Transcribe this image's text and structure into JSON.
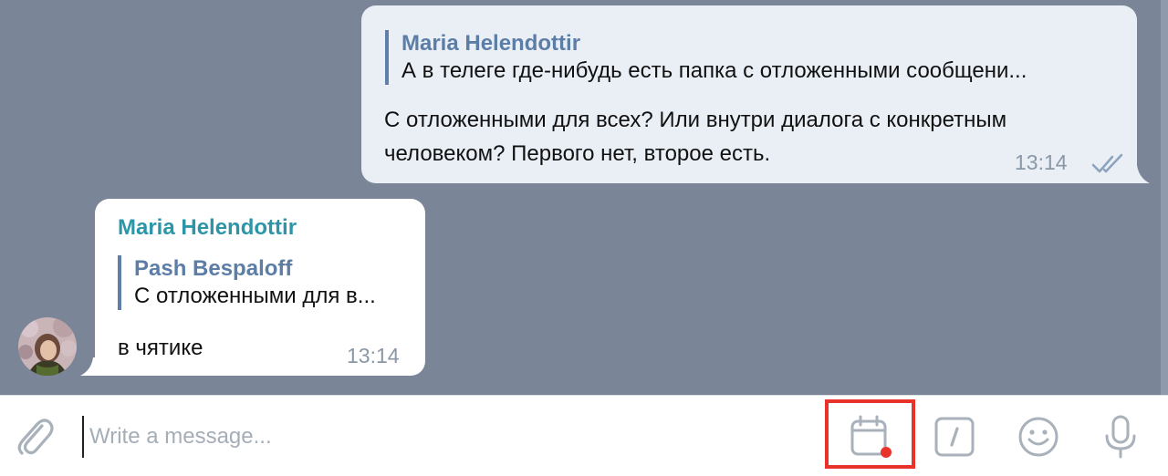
{
  "messages": {
    "outgoing": {
      "reply_author": "Maria Helendottir",
      "reply_text": "А в телеге где-нибудь есть папка с отложенными сообщени...",
      "text_line1": "С отложенными для всех? Или внутри диалога с конкретным",
      "text_line2": "человеком? Первого нет, второе есть.",
      "time": "13:14",
      "status_icon": "double-check-icon"
    },
    "incoming": {
      "sender": "Maria Helendottir",
      "reply_author": "Pash Bespaloff",
      "reply_text": "С отложенными для в...",
      "text": "в чятике",
      "time": "13:14"
    }
  },
  "composer": {
    "placeholder": "Write a message...",
    "value": "",
    "icons": [
      "attach-icon",
      "scheduled-messages-icon",
      "bot-commands-icon",
      "emoji-icon",
      "microphone-icon"
    ]
  },
  "colors": {
    "chat_background": "#7a8597",
    "outgoing_bubble": "#eaeff5",
    "incoming_bubble": "#ffffff",
    "sender_name": "#2c96a8",
    "reply_name": "#5c7ea6",
    "highlight": "#e8322a"
  }
}
